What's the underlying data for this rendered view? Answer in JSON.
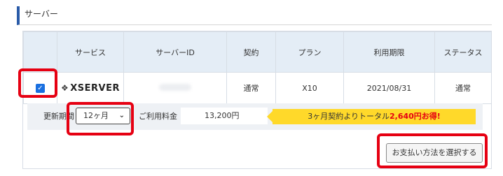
{
  "section": {
    "title": "サーバー"
  },
  "table": {
    "headers": [
      "",
      "サービス",
      "サーバーID",
      "契約",
      "プラン",
      "利用期限",
      "ステータス"
    ],
    "row": {
      "checked": true,
      "service_logo": "XSERVER",
      "server_id": "",
      "contract": "通常",
      "plan": "X10",
      "expiry": "2021/08/31",
      "status": "通常"
    }
  },
  "billing": {
    "renewal_label": "更新期間",
    "renewal_value": "12ヶ月",
    "fee_label": "ご利用料金",
    "fee_value": "13,200円",
    "promo_prefix": "3ヶ月契約よりトータル",
    "promo_amount": "2,640円お得!"
  },
  "actions": {
    "select_payment": "お支払い方法を選択する"
  },
  "colors": {
    "accent": "#2a5ba8",
    "highlight": "#e60012",
    "promo_bg": "#ffd92a",
    "header_bg": "#e4edf6"
  }
}
